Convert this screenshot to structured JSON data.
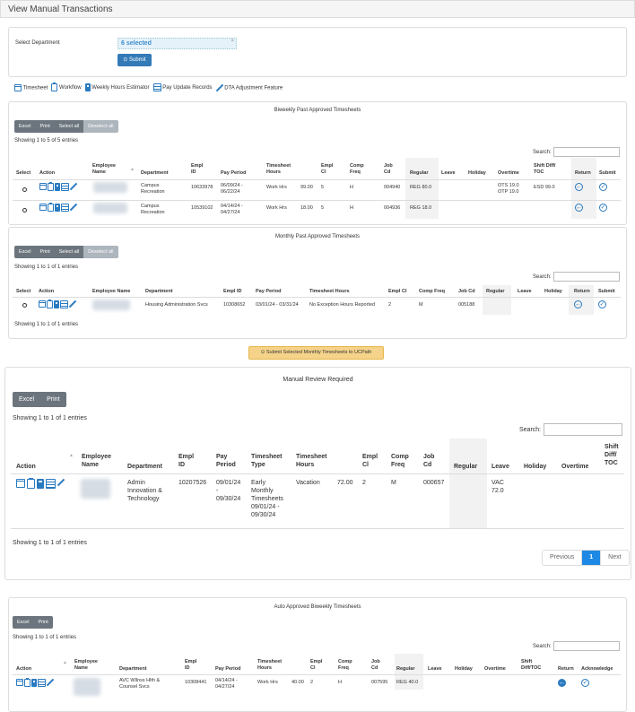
{
  "header": {
    "title": "View Manual Transactions"
  },
  "dept": {
    "label": "Select Department",
    "selected": "6 selected",
    "clear": "×",
    "submit": "Submit"
  },
  "links": [
    {
      "icon": "calendar-icon",
      "label": "Timesheet"
    },
    {
      "icon": "clipboard-icon",
      "label": "Workflow"
    },
    {
      "icon": "calculator-icon",
      "label": "Weekly Hours Estimator"
    },
    {
      "icon": "table-icon",
      "label": "Pay Update Records"
    },
    {
      "icon": "edit-icon",
      "label": "DTA Adjustment Feature"
    }
  ],
  "biweekly": {
    "title": "Biweekly Past Approved Timesheets",
    "buttons": [
      "Excel",
      "Print",
      "Select all",
      "Deselect all"
    ],
    "info": "Showing 1 to 5 of 5 entries",
    "search": "Search:",
    "headers": [
      "Select",
      "Action",
      "Employee Name",
      "Department",
      "Empl ID",
      "Pay Period",
      "Timesheet Hours",
      "Empl Cl",
      "Comp Freq",
      "Job Cd",
      "Regular",
      "Leave",
      "Holiday",
      "Overtime",
      "Shift Diff/ TOC",
      "Return",
      "Submit"
    ],
    "rows": [
      {
        "department": "Campus Recreation",
        "empl_id": "10633978",
        "pay_period": "06/09/24 - 06/22/24",
        "ts_hours": "Work Hrs",
        "hours": "99.00",
        "empl_cl": "5",
        "comp_freq": "H",
        "job_cd": "004940",
        "regular": "REG 80.0",
        "leave": "",
        "holiday": "",
        "overtime": "OTS 19.0\nOTP 19.0",
        "shift": "ESD 99.0"
      },
      {
        "department": "Campus Recreation",
        "empl_id": "10539102",
        "pay_period": "04/14/24 - 04/27/24",
        "ts_hours": "Work Hrs",
        "hours": "18.00",
        "empl_cl": "5",
        "comp_freq": "H",
        "job_cd": "004936",
        "regular": "REG 18.0",
        "leave": "",
        "holiday": "",
        "overtime": "",
        "shift": ""
      }
    ]
  },
  "monthly": {
    "title": "Monthly Past Approved Timesheets",
    "buttons": [
      "Excel",
      "Print",
      "Select all",
      "Deselect all"
    ],
    "info": "Showing 1 to 1 of 1 entries",
    "info_bottom": "Showing 1 to 1 of 1 entries",
    "search": "Search:",
    "headers": [
      "Select",
      "Action",
      "Employee Name",
      "Department",
      "Empl ID",
      "Pay Period",
      "Timesheet Hours",
      "Empl Cl",
      "Comp Freq",
      "Job Cd",
      "Regular",
      "Leave",
      "Holiday",
      "Return",
      "Submit"
    ],
    "rows": [
      {
        "department": "Housing Administration Svcs",
        "empl_id": "10308652",
        "pay_period": "03/01/24 - 03/31/24",
        "ts_hours": "No Exception Hours Reported",
        "empl_cl": "2",
        "comp_freq": "M",
        "job_cd": "005188"
      }
    ]
  },
  "submit_monthly": "Submit Selected Monthly Timesheets to UCPath",
  "manual": {
    "title": "Manual Review Required",
    "buttons": [
      "Excel",
      "Print"
    ],
    "info": "Showing 1 to 1 of 1 entries",
    "info_bottom": "Showing 1 to 1 of 1 entries",
    "search": "Search:",
    "headers": [
      "Action",
      "Employee Name",
      "Department",
      "Empl ID",
      "Pay Period",
      "Timesheet Type",
      "Timesheet Hours",
      "Empl Cl",
      "Comp Freq",
      "Job Cd",
      "Regular",
      "Leave",
      "Holiday",
      "Overtime",
      "Shift Diff/ TOC"
    ],
    "row": {
      "department": "Admin Innovation & Technology",
      "empl_id": "10207526",
      "pay_period": "09/01/24 - 09/30/24",
      "ts_type": "Early Monthly Timesheets 09/01/24 - 09/30/24",
      "ts_hours": "Vacation",
      "hours": "72.00",
      "empl_cl": "2",
      "comp_freq": "M",
      "job_cd": "000657",
      "leave": "VAC 72.0"
    },
    "pager": [
      "Previous",
      "1",
      "Next"
    ]
  },
  "auto": {
    "title": "Auto Approved Biweekly Timesheets",
    "buttons": [
      "Excel",
      "Print"
    ],
    "info": "Showing 1 to 1 of 1 entries",
    "search": "Search:",
    "headers": [
      "Action",
      "Employee Name",
      "Department",
      "Empl ID",
      "Pay Period",
      "Timesheet Hours",
      "Empl Cl",
      "Comp Freq",
      "Job Cd",
      "Regular",
      "Leave",
      "Holiday",
      "Overtime",
      "Shift Diff/TOC",
      "Return",
      "Acknowledge"
    ],
    "row": {
      "department": "AVC Wllnss Hlth & Counsel Svcs",
      "empl_id": "10308441",
      "pay_period": "04/14/24 - 04/27/24",
      "ts_hours": "Work Hrs",
      "hours": "40.00",
      "empl_cl": "2",
      "comp_freq": "H",
      "job_cd": "007595",
      "regular": "REG 40.0"
    }
  },
  "colors": {
    "accent": "#337ab7",
    "btn_gray": "#6c757d",
    "orange": "#f5d38a"
  }
}
